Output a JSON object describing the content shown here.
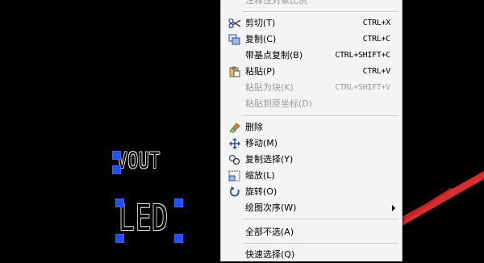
{
  "canvas": {
    "texts": [
      {
        "id": "vout",
        "text": "VOUT"
      },
      {
        "id": "led",
        "text": "LED"
      }
    ]
  },
  "context_menu": {
    "items": [
      {
        "label": "注释性对象比例",
        "shortcut": "",
        "icon": "",
        "disabled": true,
        "cut_off": true
      },
      {
        "label": "剪切(T)",
        "shortcut": "CTRL+X",
        "icon": "scissors-icon",
        "disabled": false
      },
      {
        "label": "复制(C)",
        "shortcut": "CTRL+C",
        "icon": "copy-icon",
        "disabled": false
      },
      {
        "label": "带基点复制(B)",
        "shortcut": "CTRL+SHIFT+C",
        "icon": "",
        "disabled": false
      },
      {
        "label": "粘贴(P)",
        "shortcut": "CTRL+V",
        "icon": "paste-icon",
        "disabled": false
      },
      {
        "label": "粘贴为块(K)",
        "shortcut": "CTRL+SHIFT+V",
        "icon": "",
        "disabled": true
      },
      {
        "label": "粘贴到原坐标(D)",
        "shortcut": "",
        "icon": "",
        "disabled": true
      },
      {
        "label": "删除",
        "shortcut": "",
        "icon": "eraser-icon",
        "disabled": false
      },
      {
        "label": "移动(M)",
        "shortcut": "",
        "icon": "move-icon",
        "disabled": false
      },
      {
        "label": "复制选择(Y)",
        "shortcut": "",
        "icon": "copy-selection-icon",
        "disabled": false
      },
      {
        "label": "缩放(L)",
        "shortcut": "",
        "icon": "scale-icon",
        "disabled": false
      },
      {
        "label": "旋转(O)",
        "shortcut": "",
        "icon": "rotate-icon",
        "disabled": false
      },
      {
        "label": "绘图次序(W)",
        "shortcut": "",
        "icon": "",
        "disabled": false,
        "submenu": true
      },
      {
        "label": "全部不选(A)",
        "shortcut": "",
        "icon": "",
        "disabled": false
      },
      {
        "label": "快速选择(Q)",
        "shortcut": "",
        "icon": "",
        "disabled": false,
        "cut_off": true
      }
    ]
  },
  "colors": {
    "canvas_background": "#000000",
    "grip_color": "#1f4fff",
    "arrow_color": "#d62d2d",
    "menu_background": "#f4f4f4",
    "disabled_text": "#9a9a9a"
  }
}
